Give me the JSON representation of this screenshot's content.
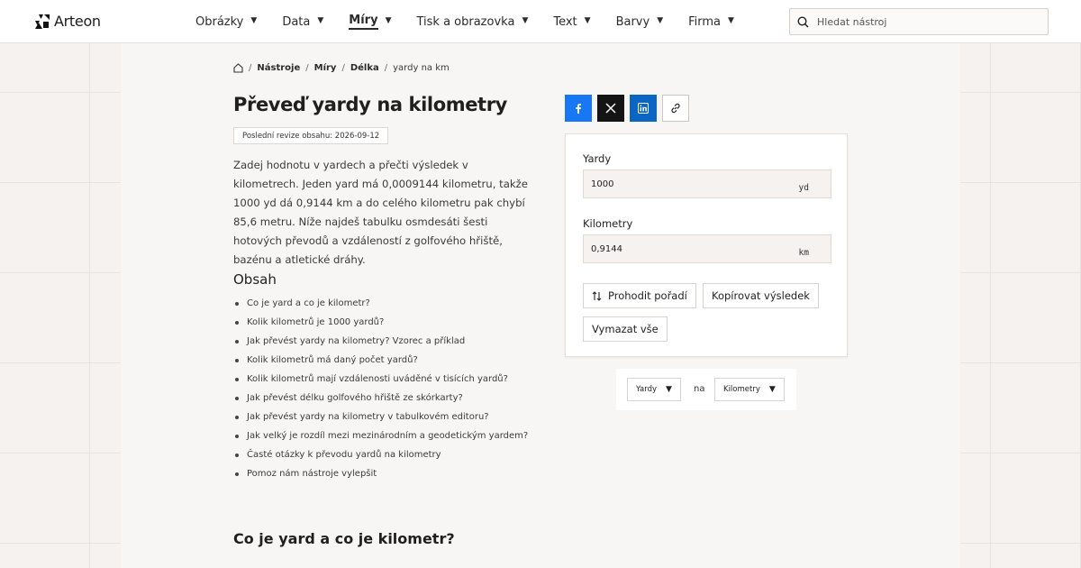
{
  "header": {
    "brand": "Arteon",
    "nav": [
      {
        "label": "Obrázky",
        "active": false
      },
      {
        "label": "Data",
        "active": false
      },
      {
        "label": "Míry",
        "active": true
      },
      {
        "label": "Tisk a obrazovka",
        "active": false
      },
      {
        "label": "Text",
        "active": false
      },
      {
        "label": "Barvy",
        "active": false
      },
      {
        "label": "Firma",
        "active": false
      }
    ],
    "search_placeholder": "Hledat nástroj"
  },
  "breadcrumb": {
    "home_icon": "home-icon",
    "items": [
      "Nástroje",
      "Míry",
      "Délka"
    ],
    "current": "yardy na km"
  },
  "page": {
    "title": "Převeď yardy na kilometry",
    "revision": "Poslední revize obsahu: 2026-09-12",
    "intro": "Zadej hodnotu v yardech a přečti výsledek v kilometrech. Jeden yard má 0,0009144 kilometru, takže 1000 yd dá 0,9144 km a do celého kilometru pak chybí 85,6 metru. Níže najdeš tabulku osmdesáti šesti hotových převodů a vzdáleností z golfového hřiště, bazénu a atletické dráhy."
  },
  "toc": {
    "title": "Obsah",
    "items": [
      "Co je yard a co je kilometr?",
      "Kolik kilometrů je 1000 yardů?",
      "Jak převést yardy na kilometry? Vzorec a příklad",
      "Kolik kilometrů má daný počet yardů?",
      "Kolik kilometrů mají vzdálenosti uváděné v tisících yardů?",
      "Jak převést délku golfového hřiště ze skórkarty?",
      "Jak převést yardy na kilometry v tabulkovém editoru?",
      "Jak velký je rozdíl mezi mezinárodním a geodetickým yardem?",
      "Časté otázky k převodu yardů na kilometry",
      "Pomoz nám nástroje vylepšit"
    ]
  },
  "section": {
    "heading": "Co je yard a co je kilometr?"
  },
  "share": {
    "icons": [
      "facebook-icon",
      "x-icon",
      "linkedin-icon",
      "link-icon"
    ],
    "colors": {
      "facebook": "#1877f2",
      "x": "#141414",
      "linkedin": "#0a66c2"
    }
  },
  "converter": {
    "from_label": "Yardy",
    "from_value": "1000",
    "from_unit": "yd",
    "to_label": "Kilometry",
    "to_value": "0,9144",
    "to_unit": "km",
    "swap_label": "Prohodit pořadí",
    "copy_label": "Kopírovat výsledek",
    "clear_label": "Vymazat vše"
  },
  "unit_selector": {
    "from": "Yardy",
    "connector": "na",
    "to": "Kilometry"
  }
}
